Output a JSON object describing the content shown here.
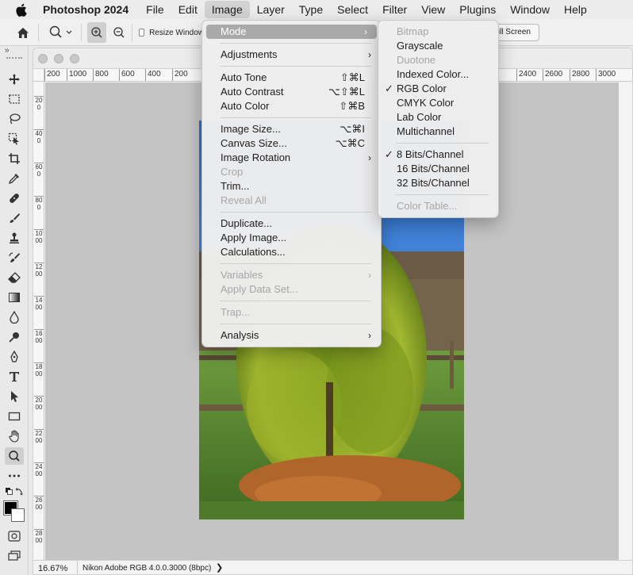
{
  "menubar": {
    "app_name": "Photoshop 2024",
    "items": [
      "File",
      "Edit",
      "Image",
      "Layer",
      "Type",
      "Select",
      "Filter",
      "View",
      "Plugins",
      "Window",
      "Help"
    ],
    "active": "Image"
  },
  "options_bar": {
    "resize_windows_label": "Resize Window",
    "fill_screen_label": "Fill Screen"
  },
  "rulers": {
    "top_ticks": [
      "200",
      "1000",
      "800",
      "600",
      "400",
      "200",
      "2400",
      "2600",
      "2800",
      "3000"
    ],
    "left_ticks": [
      "200",
      "400",
      "600",
      "800",
      "1000",
      "1200",
      "1400",
      "1600",
      "1800",
      "2000",
      "2200",
      "2400",
      "2600",
      "2800"
    ]
  },
  "status_bar": {
    "zoom": "16.67%",
    "profile": "Nikon Adobe RGB 4.0.0.3000 (8bpc)",
    "arrow": "❯"
  },
  "image_menu": {
    "groups": [
      [
        {
          "label": "Mode",
          "submenu": true,
          "highlighted": true
        }
      ],
      [
        {
          "label": "Adjustments",
          "submenu": true
        }
      ],
      [
        {
          "label": "Auto Tone",
          "shortcut": "⇧⌘L"
        },
        {
          "label": "Auto Contrast",
          "shortcut": "⌥⇧⌘L"
        },
        {
          "label": "Auto Color",
          "shortcut": "⇧⌘B"
        }
      ],
      [
        {
          "label": "Image Size...",
          "shortcut": "⌥⌘I"
        },
        {
          "label": "Canvas Size...",
          "shortcut": "⌥⌘C"
        },
        {
          "label": "Image Rotation",
          "submenu": true
        },
        {
          "label": "Crop",
          "disabled": true
        },
        {
          "label": "Trim..."
        },
        {
          "label": "Reveal All",
          "disabled": true
        }
      ],
      [
        {
          "label": "Duplicate..."
        },
        {
          "label": "Apply Image..."
        },
        {
          "label": "Calculations..."
        }
      ],
      [
        {
          "label": "Variables",
          "submenu": true,
          "disabled": true
        },
        {
          "label": "Apply Data Set...",
          "disabled": true
        }
      ],
      [
        {
          "label": "Trap...",
          "disabled": true
        }
      ],
      [
        {
          "label": "Analysis",
          "submenu": true
        }
      ]
    ]
  },
  "mode_submenu": {
    "groups": [
      [
        {
          "label": "Bitmap",
          "disabled": true
        },
        {
          "label": "Grayscale"
        },
        {
          "label": "Duotone",
          "disabled": true
        },
        {
          "label": "Indexed Color..."
        },
        {
          "label": "RGB Color",
          "checked": true
        },
        {
          "label": "CMYK Color"
        },
        {
          "label": "Lab Color"
        },
        {
          "label": "Multichannel"
        }
      ],
      [
        {
          "label": "8 Bits/Channel",
          "checked": true
        },
        {
          "label": "16 Bits/Channel"
        },
        {
          "label": "32 Bits/Channel"
        }
      ],
      [
        {
          "label": "Color Table...",
          "disabled": true
        }
      ]
    ]
  },
  "colors": {
    "menu_highlight": "#a9a9a9",
    "canvas_bg": "#c4c4c4",
    "disabled_text": "#a6a6a6"
  }
}
